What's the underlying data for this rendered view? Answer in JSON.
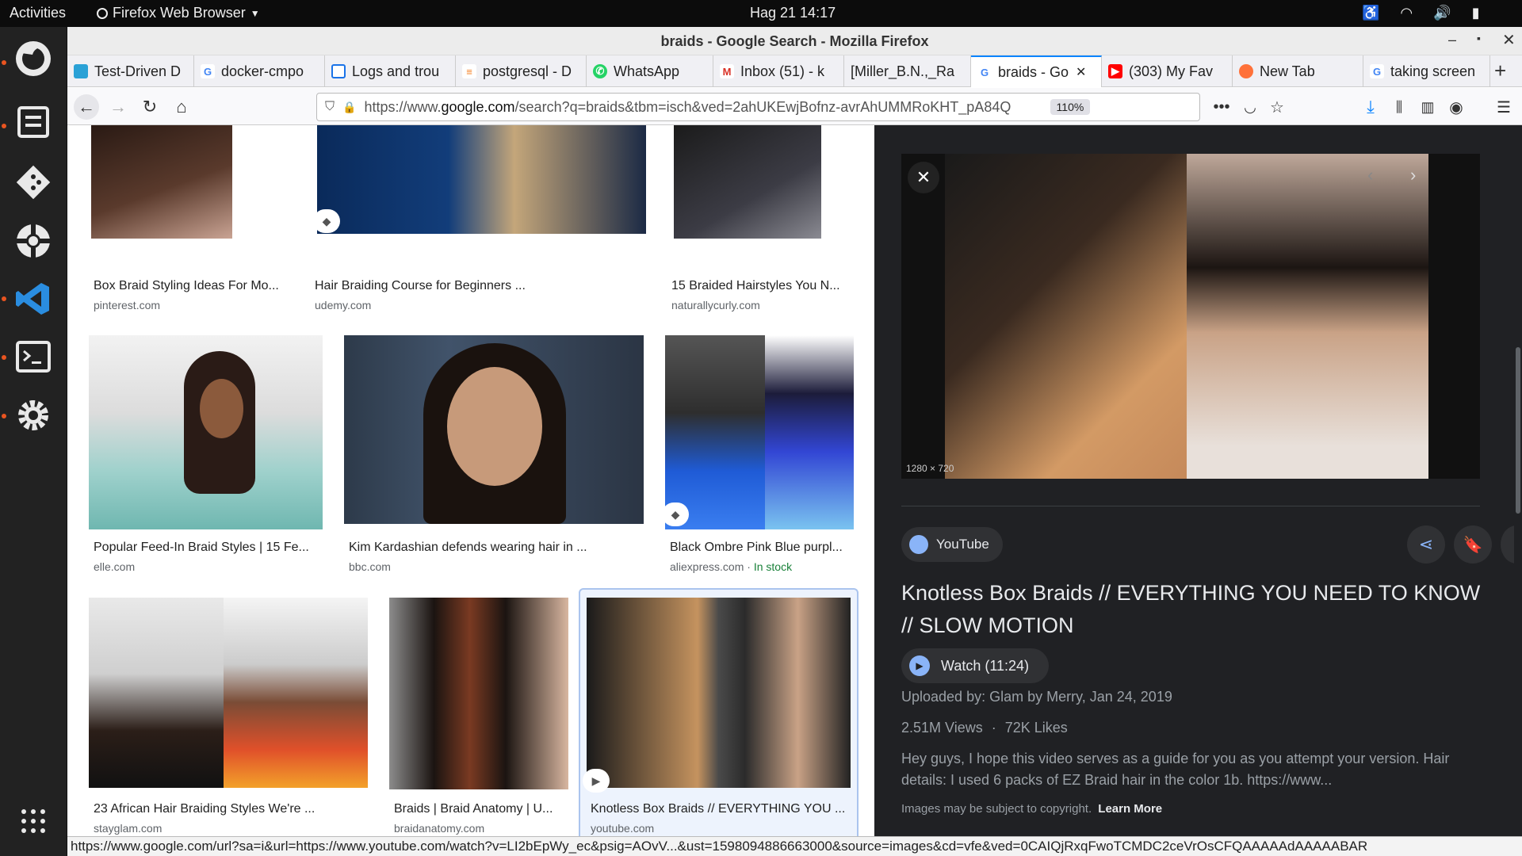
{
  "topbar": {
    "activities": "Activities",
    "app_menu": "Firefox Web Browser",
    "clock": "Hag 21  14:17"
  },
  "window": {
    "title": "braids - Google Search - Mozilla Firefox"
  },
  "tabs": [
    {
      "label": "Test-Driven D",
      "favicon": "box-icon",
      "color": "#2aa1d6"
    },
    {
      "label": "docker-cmpo",
      "favicon": "google-icon",
      "color": "#4285f4"
    },
    {
      "label": "Logs and trou",
      "favicon": "logs-icon",
      "color": "#1a73e8"
    },
    {
      "label": "postgresql - D",
      "favicon": "stackoverflow-icon",
      "color": "#f48024"
    },
    {
      "label": "WhatsApp",
      "favicon": "whatsapp-icon",
      "color": "#25d366"
    },
    {
      "label": "Inbox (51) - k",
      "favicon": "gmail-icon",
      "color": "#d93025"
    },
    {
      "label": "[Miller_B.N.,_Ra",
      "favicon": "",
      "color": ""
    },
    {
      "label": "braids - Go",
      "favicon": "google-icon",
      "color": "#4285f4",
      "active": true
    },
    {
      "label": "(303) My Fav",
      "favicon": "youtube-icon",
      "color": "#ff0000"
    },
    {
      "label": "New Tab",
      "favicon": "firefox-icon",
      "color": "#ff7139"
    },
    {
      "label": "taking screen",
      "favicon": "google-icon",
      "color": "#4285f4"
    }
  ],
  "nav": {
    "url_prefix": "https://www.",
    "url_domain": "google.com",
    "url_rest": "/search?q=braids&tbm=isch&ved=2ahUKEwjBofnz-avrAhUMMRoKHT_pA84Q",
    "zoom": "110%"
  },
  "results": [
    {
      "title": "Box Braid Styling Ideas For Mo...",
      "source": "pinterest.com"
    },
    {
      "title": "Hair Braiding Course for Beginners ...",
      "source": "udemy.com"
    },
    {
      "title": "15 Braided Hairstyles You N...",
      "source": "naturallycurly.com"
    },
    {
      "title": "Popular Feed-In Braid Styles | 15 Fe...",
      "source": "elle.com"
    },
    {
      "title": "Kim Kardashian defends wearing hair in ...",
      "source": "bbc.com"
    },
    {
      "title": "Black Ombre Pink Blue purpl...",
      "source": "aliexpress.com",
      "extra": "In stock",
      "extra_sep": "·"
    },
    {
      "title": "23 African Hair Braiding Styles We're ...",
      "source": "stayglam.com"
    },
    {
      "title": "Braids | Braid Anatomy | U...",
      "source": "braidanatomy.com"
    },
    {
      "title": "Knotless Box Braids // EVERYTHING YOU ...",
      "source": "youtube.com"
    }
  ],
  "panel": {
    "dimensions": "1280 × 720",
    "site": "YouTube",
    "title": "Knotless Box Braids // EVERYTHING YOU NEED TO KNOW // SLOW MOTION",
    "watch": "Watch (11:24)",
    "uploaded": "Uploaded by: Glam by Merry, Jan 24, 2019",
    "views": "2.51M Views",
    "likes": "72K Likes",
    "stats_sep": "·",
    "description": "Hey guys, I hope this video serves as a guide for you as you attempt your version. Hair details: I used 6 packs of EZ Braid hair in the color 1b. https://www...",
    "copyright": "Images may be subject to copyright.",
    "learn_more": "Learn More"
  },
  "status_url": "https://www.google.com/url?sa=i&url=https://www.youtube.com/watch?v=LI2bEpWy_ec&psig=AOvV...&ust=1598094886663000&source=images&cd=vfe&ved=0CAIQjRxqFwoTCMDC2ceVrOsCFQAAAAAdAAAAABAR",
  "colors": {
    "accent": "#1a73e8",
    "in_stock": "#188038",
    "ubuntu_orange": "#e95420"
  }
}
